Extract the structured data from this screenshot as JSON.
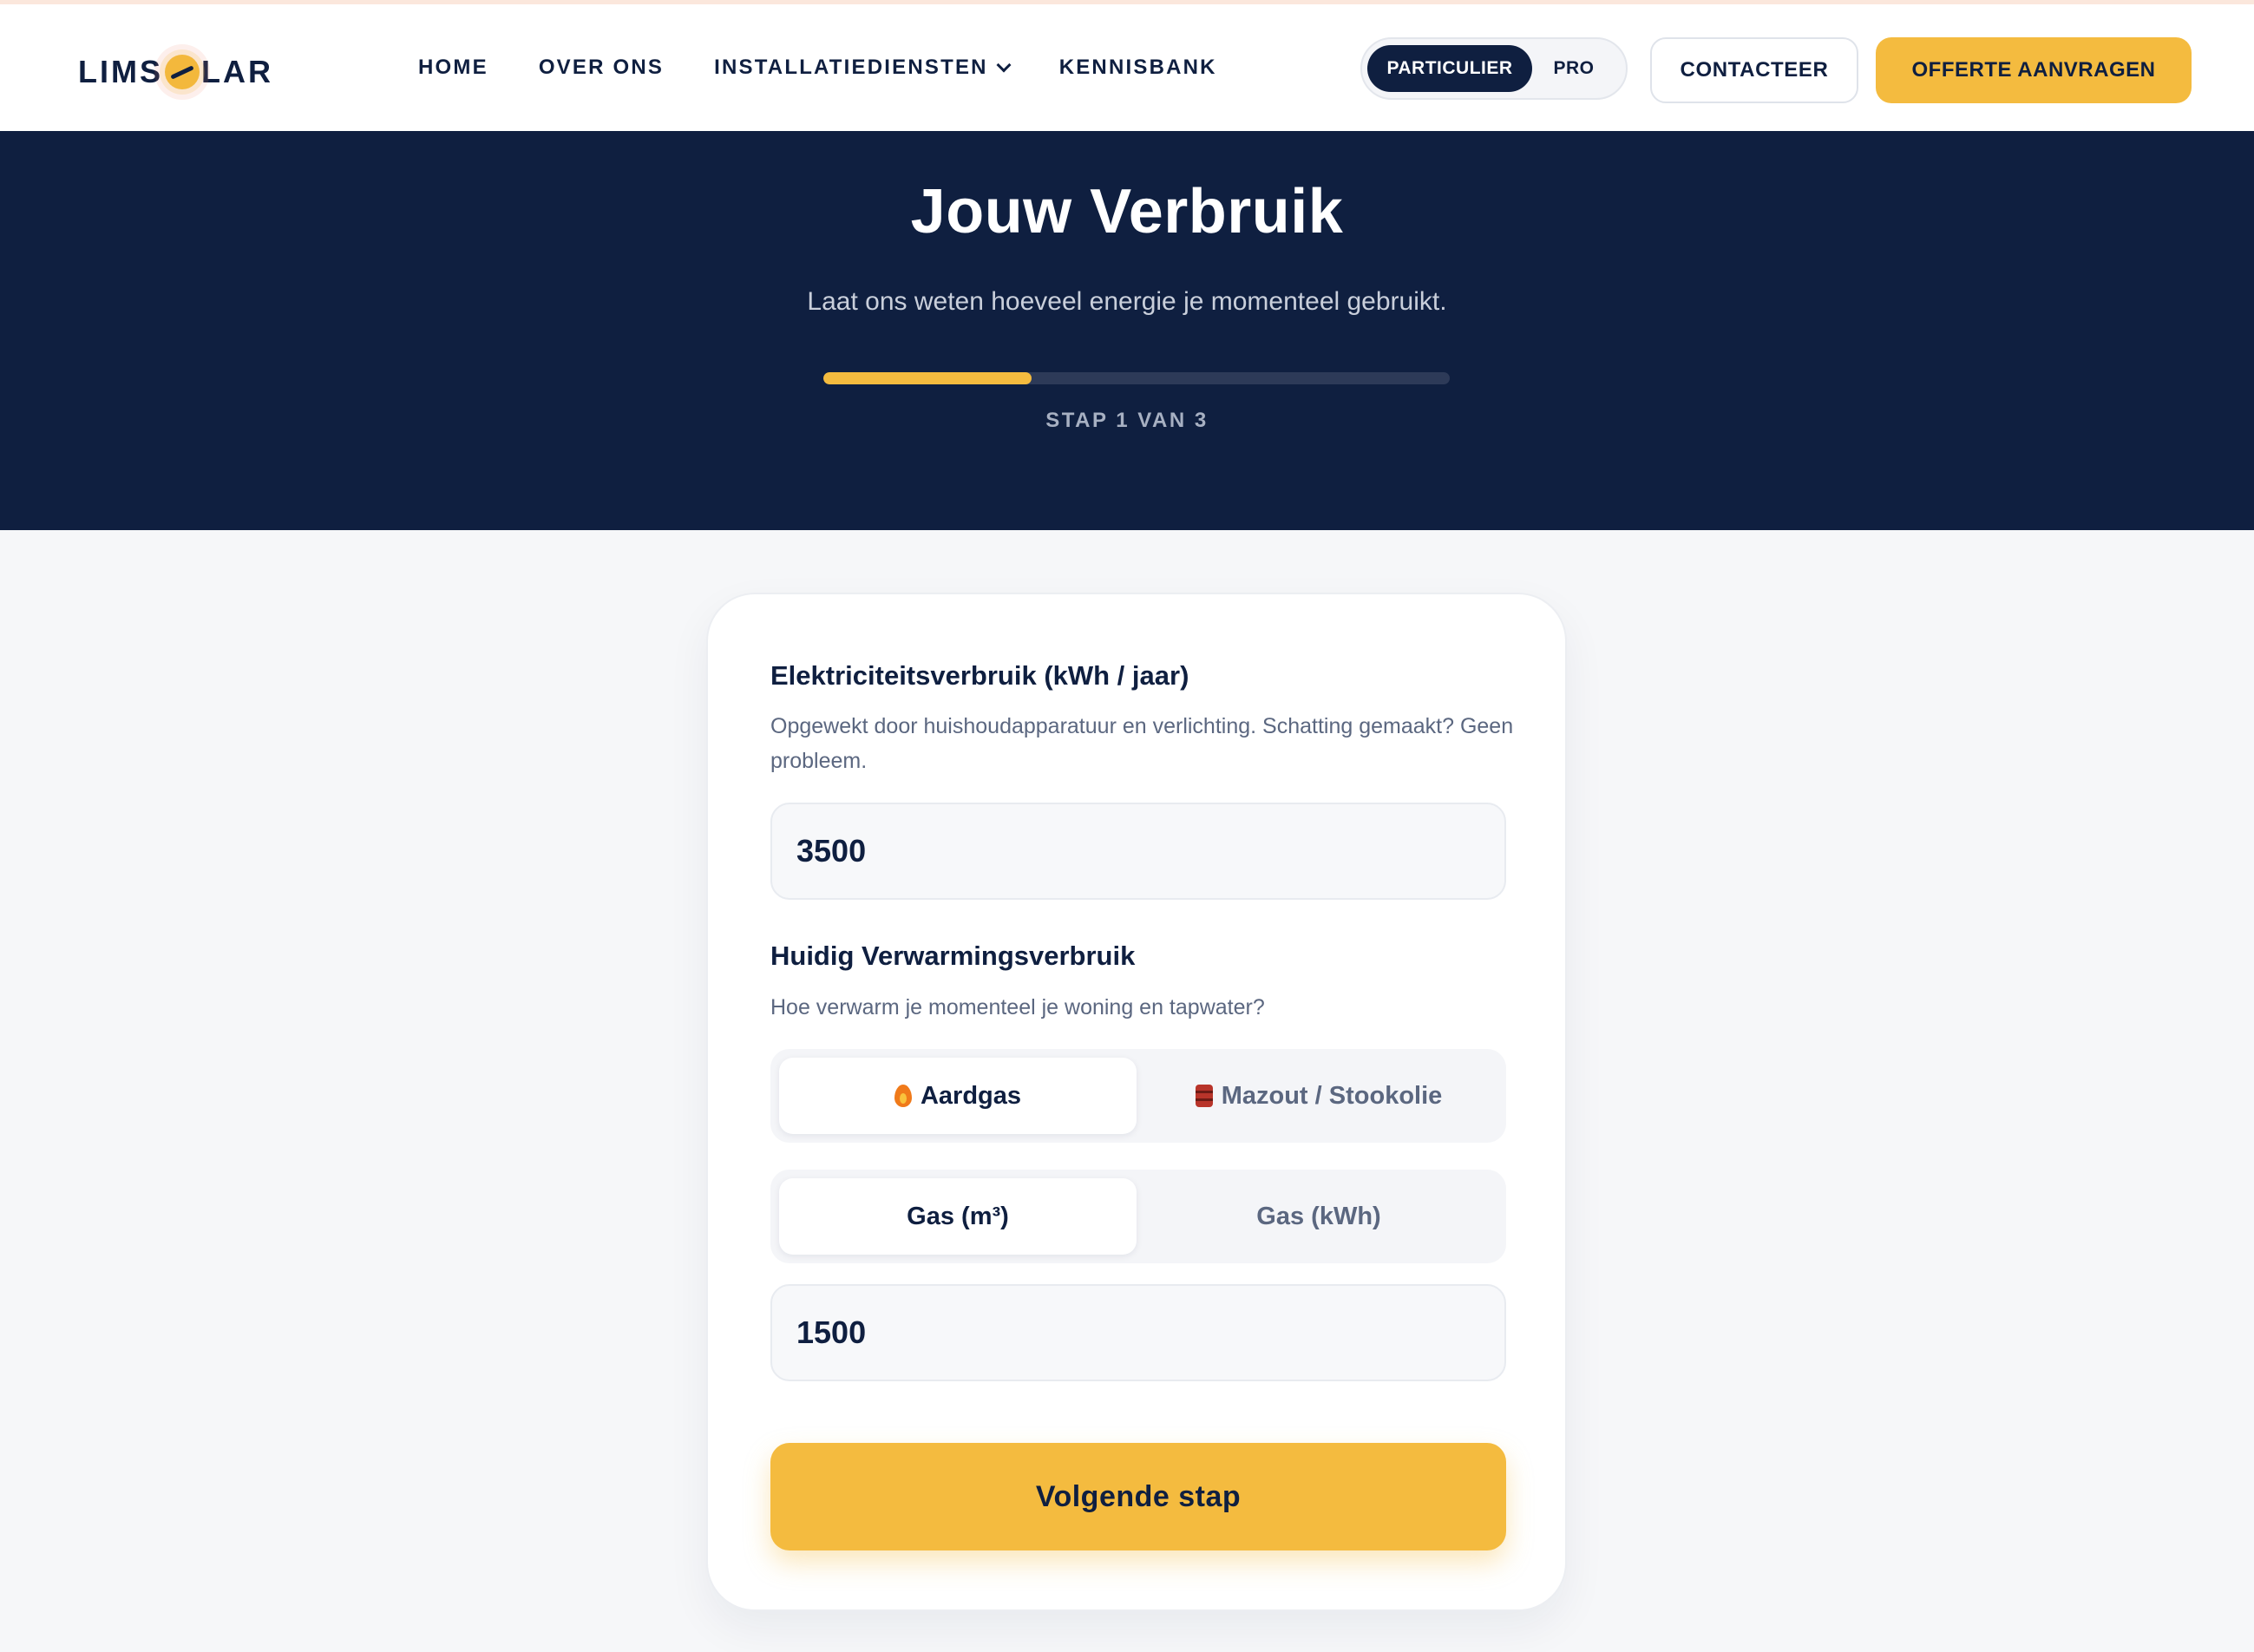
{
  "brand": {
    "logo_text_left": "LIMS",
    "logo_text_right": "LAR"
  },
  "nav": {
    "items": [
      {
        "label": "HOME"
      },
      {
        "label": "OVER ONS"
      },
      {
        "label": "INSTALLATIEDIENSTEN"
      },
      {
        "label": "KENNISBANK"
      }
    ]
  },
  "audience": {
    "options": [
      "PARTICULIER",
      "PRO"
    ],
    "selected": "PARTICULIER"
  },
  "header_buttons": {
    "contact": "CONTACTEER",
    "quote": "OFFERTE AANVRAGEN"
  },
  "hero": {
    "title": "Jouw Verbruik",
    "subtitle": "Laat ons weten hoeveel energie je momenteel gebruikt.",
    "progress_fraction": 0.333,
    "step_text": "STAP 1 VAN 3"
  },
  "form": {
    "electricity": {
      "label": "Elektriciteitsverbruik (kWh / jaar)",
      "help": "Opgewekt door huishoudapparatuur en verlichting. Schatting gemaakt? Geen probleem.",
      "value": "3500"
    },
    "heating": {
      "label": "Huidig Verwarmingsverbruik",
      "help": "Hoe verwarm je momenteel je woning en tapwater?",
      "fuel_options": [
        {
          "label": "Aardgas",
          "icon": "flame-icon",
          "selected": true
        },
        {
          "label": "Mazout / Stookolie",
          "icon": "oil-barrel-icon",
          "selected": false
        }
      ],
      "unit_options": [
        {
          "label": "Gas (m³)",
          "selected": true
        },
        {
          "label": "Gas (kWh)",
          "selected": false
        }
      ],
      "value": "1500"
    },
    "next_label": "Volgende stap"
  },
  "colors": {
    "navy": "#0f1f40",
    "accent": "#f4bb3f",
    "background": "#f6f7f9"
  }
}
